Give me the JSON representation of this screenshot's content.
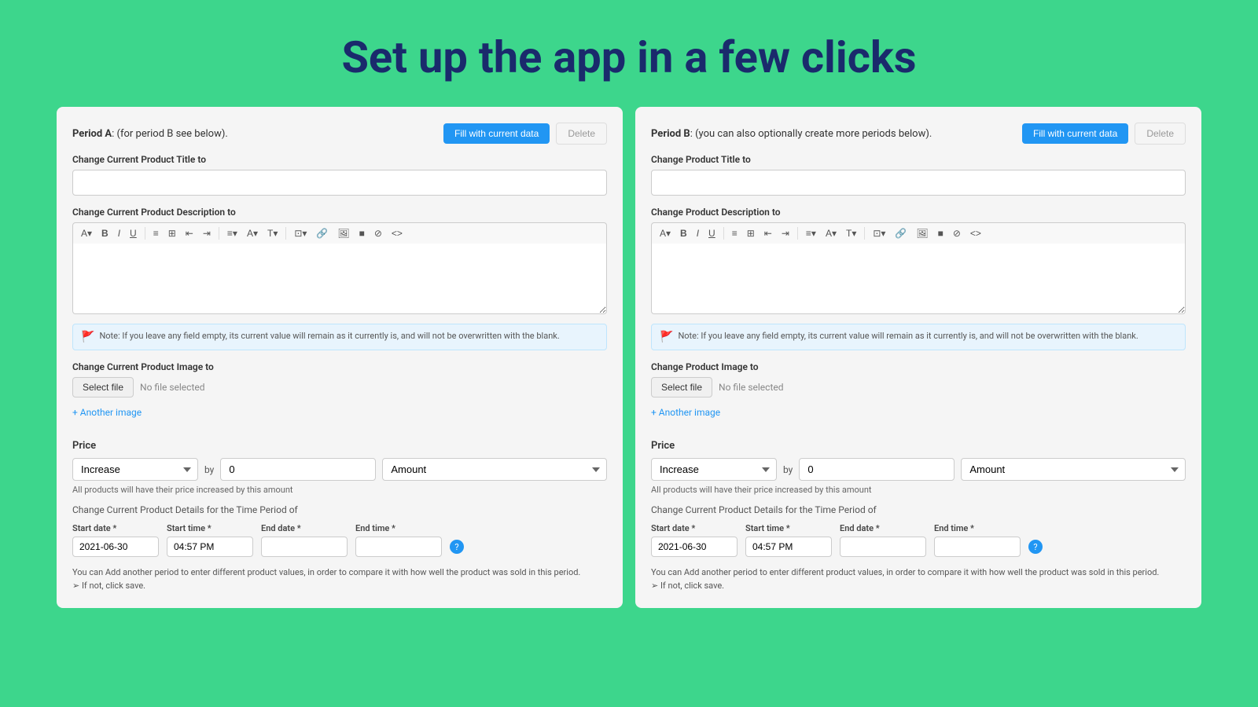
{
  "header": {
    "title": "Set up the app in a few clicks"
  },
  "panel_a": {
    "period_label": "Period A",
    "period_desc": ": (for period B see below).",
    "fill_button": "Fill with current data",
    "delete_button": "Delete",
    "title_label": "Change Current Product Title to",
    "description_label": "Change Current Product Description to",
    "note_text": "Note: If you leave any field empty, its current value will remain as it currently is, and will not be overwritten with the blank.",
    "image_label": "Change Current Product Image to",
    "select_file": "Select file",
    "no_file": "No file selected",
    "another_image": "+ Another image",
    "price_label": "Price",
    "increase_label": "Increase",
    "by_label": "by",
    "price_value": "0",
    "amount_label": "Amount",
    "price_note": "All products will have their price increased by this amount",
    "time_period_label": "Change Current Product Details for the Time Period of",
    "start_date_label": "Start date *",
    "start_time_label": "Start time *",
    "end_date_label": "End date *",
    "end_time_label": "End time *",
    "start_date_value": "2021-06-30",
    "start_time_value": "04:57 PM",
    "end_date_value": "",
    "end_time_value": "",
    "bottom_note": "You can Add another period to enter different product values, in order to compare it with how well the product was sold in this period.",
    "bottom_note2": "➢  If not, click save."
  },
  "panel_b": {
    "period_label": "Period B",
    "period_desc": ": (you can also optionally create more periods below).",
    "fill_button": "Fill with current data",
    "delete_button": "Delete",
    "title_label": "Change Product Title to",
    "description_label": "Change Product Description to",
    "note_text": "Note: If you leave any field empty, its current value will remain as it currently is, and will not be overwritten with the blank.",
    "image_label": "Change Product Image to",
    "select_file": "Select file",
    "no_file": "No file selected",
    "another_image": "+ Another image",
    "price_label": "Price",
    "increase_label": "Increase",
    "by_label": "by",
    "price_value": "0",
    "amount_label": "Amount",
    "price_note": "All products will have their price increased by this amount",
    "time_period_label": "Change Current Product Details for the Time Period of",
    "start_date_label": "Start date *",
    "start_time_label": "Start time *",
    "end_date_label": "End date *",
    "end_time_label": "End time *",
    "start_date_value": "2021-06-30",
    "start_time_value": "04:57 PM",
    "end_date_value": "",
    "end_time_value": "",
    "bottom_note": "You can Add another period to enter different product values, in order to compare it with how well the product was sold in this period.",
    "bottom_note2": "➢  If not, click save."
  },
  "toolbar": {
    "items": [
      "A▾",
      "B",
      "I",
      "U",
      "≡",
      "⊞",
      "⇤",
      "⇥",
      "≡▾",
      "A▾",
      "T▾",
      "⊡▾",
      "⊞",
      "🔗",
      "🖼",
      "■",
      "⊘",
      "<>"
    ]
  }
}
